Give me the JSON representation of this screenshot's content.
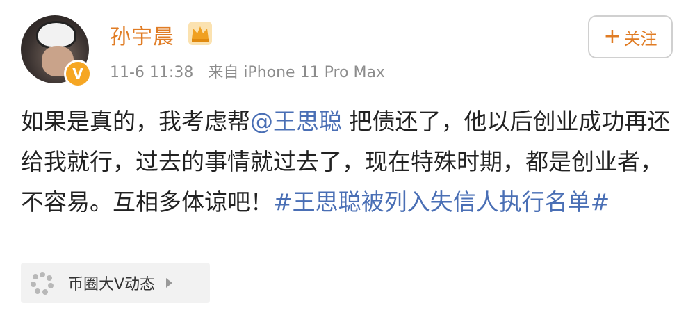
{
  "post": {
    "author": "孙宇晨",
    "verified_badge": "V",
    "time": "11-6 11:38",
    "source": "来自 iPhone 11 Pro Max",
    "follow_plus": "+",
    "follow_label": "关注",
    "text_part1": "如果是真的，我考虑帮",
    "mention": "@王思聪",
    "text_part2": " 把债还了，他以后创业成功再还给我就行，过去的事情就过去了，现在特殊时期，都是创业者，不容易。互相多体谅吧！",
    "hashtag": "#王思聪被列入失信人执行名单#",
    "topic_card_label": "币圈大V动态"
  },
  "colors": {
    "author": "#e07c24",
    "link": "#4a6fb5",
    "meta": "#8c8c8c",
    "badge": "#f6a623"
  },
  "icons": [
    "crown-icon",
    "verified-v-icon",
    "pinwheel-icon",
    "chevron-right-icon"
  ]
}
